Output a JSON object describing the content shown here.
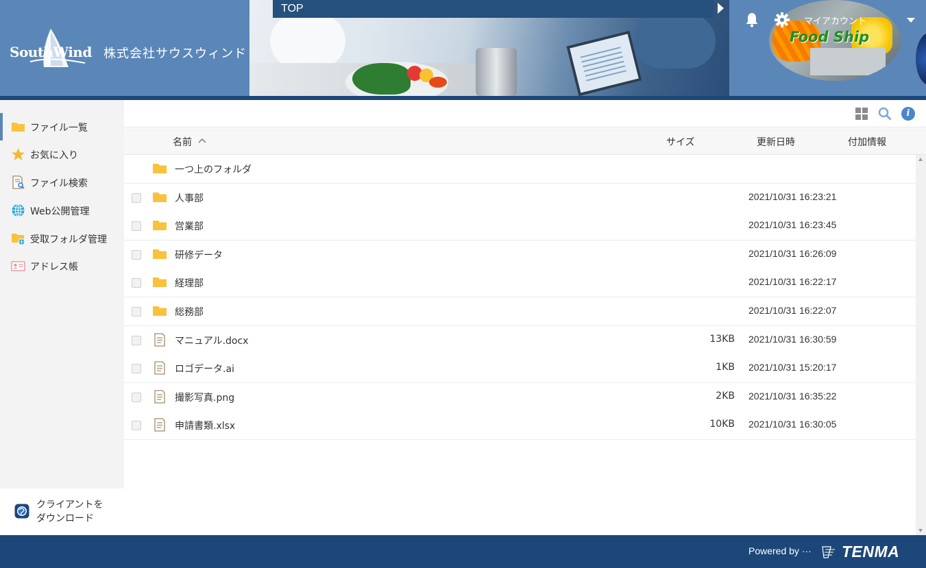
{
  "header": {
    "logo_text": "SouthWind",
    "company_name": "株式会社サウスウィンド",
    "breadcrumb": "TOP",
    "account_label": "マイアカウント",
    "avatar_text": "Food Ship"
  },
  "sidebar": {
    "items": [
      {
        "label": "ファイル一覧",
        "icon": "folder-icon",
        "active": true
      },
      {
        "label": "お気に入り",
        "icon": "star-icon",
        "active": false
      },
      {
        "label": "ファイル検索",
        "icon": "file-search-icon",
        "active": false
      },
      {
        "label": "Web公開管理",
        "icon": "globe-icon",
        "active": false
      },
      {
        "label": "受取フォルダ管理",
        "icon": "folder-globe-icon",
        "active": false
      },
      {
        "label": "アドレス帳",
        "icon": "address-card-icon",
        "active": false
      }
    ],
    "download_label": "クライアントを\nダウンロード"
  },
  "columns": {
    "name": "名前",
    "size": "サイズ",
    "modified": "更新日時",
    "extra": "付加情報"
  },
  "files": [
    {
      "name": "一つ上のフォルダ",
      "type": "folder",
      "size": "",
      "modified": "",
      "checkbox": false
    },
    {
      "name": "人事部",
      "type": "folder",
      "size": "",
      "modified": "2021/10/31 16:23:21",
      "checkbox": true
    },
    {
      "name": "営業部",
      "type": "folder",
      "size": "",
      "modified": "2021/10/31 16:23:45",
      "checkbox": true
    },
    {
      "name": "研修データ",
      "type": "folder",
      "size": "",
      "modified": "2021/10/31 16:26:09",
      "checkbox": true
    },
    {
      "name": "経理部",
      "type": "folder",
      "size": "",
      "modified": "2021/10/31 16:22:17",
      "checkbox": true
    },
    {
      "name": "総務部",
      "type": "folder",
      "size": "",
      "modified": "2021/10/31 16:22:07",
      "checkbox": true
    },
    {
      "name": "マニュアル.docx",
      "type": "file",
      "size": "13KB",
      "modified": "2021/10/31 16:30:59",
      "checkbox": true
    },
    {
      "name": "ロゴデータ.ai",
      "type": "file",
      "size": "1KB",
      "modified": "2021/10/31 15:20:17",
      "checkbox": true
    },
    {
      "name": "撮影写真.png",
      "type": "file",
      "size": "2KB",
      "modified": "2021/10/31 16:35:22",
      "checkbox": true
    },
    {
      "name": "申請書類.xlsx",
      "type": "file",
      "size": "10KB",
      "modified": "2021/10/31 16:30:05",
      "checkbox": true
    }
  ],
  "footer": {
    "powered_by": "Powered by ···",
    "brand": "TENMA"
  },
  "colors": {
    "header_blue": "#5b87b8",
    "dark_navy": "#1d4778",
    "folder_yellow": "#f9c23c",
    "info_blue": "#4a86c8"
  }
}
